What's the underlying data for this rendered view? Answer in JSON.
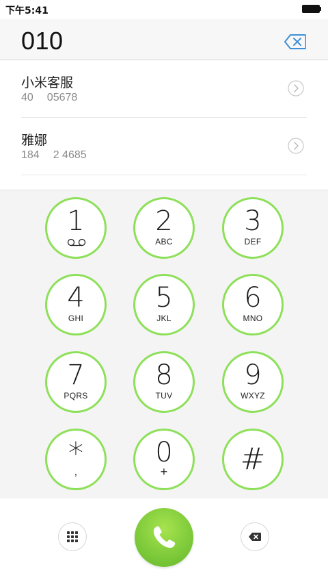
{
  "status_bar": {
    "time": "下午5:41",
    "battery_icon": "battery-full-icon"
  },
  "dialer": {
    "number": "010",
    "delete_icon": "backspace-icon",
    "accent_color": "#8ee05a"
  },
  "contacts": [
    {
      "name": "小米客服",
      "num_a": "40",
      "num_b": "05678"
    },
    {
      "name": "雅娜",
      "num_a": "184",
      "num_b": "2 4685"
    }
  ],
  "keypad": [
    {
      "digit": "1",
      "letters": "",
      "icon": "voicemail-icon"
    },
    {
      "digit": "2",
      "letters": "ABC"
    },
    {
      "digit": "3",
      "letters": "DEF"
    },
    {
      "digit": "4",
      "letters": "GHI"
    },
    {
      "digit": "5",
      "letters": "JKL"
    },
    {
      "digit": "6",
      "letters": "MNO"
    },
    {
      "digit": "7",
      "letters": "PQRS"
    },
    {
      "digit": "8",
      "letters": "TUV"
    },
    {
      "digit": "9",
      "letters": "WXYZ"
    },
    {
      "digit": "*",
      "letters": ","
    },
    {
      "digit": "0",
      "letters": "+"
    },
    {
      "digit": "#",
      "letters": ""
    }
  ],
  "bottom_bar": {
    "left_icon": "dialpad-grid-icon",
    "call_icon": "phone-icon",
    "right_icon": "backspace-icon",
    "call_color": "#7cc93a"
  }
}
